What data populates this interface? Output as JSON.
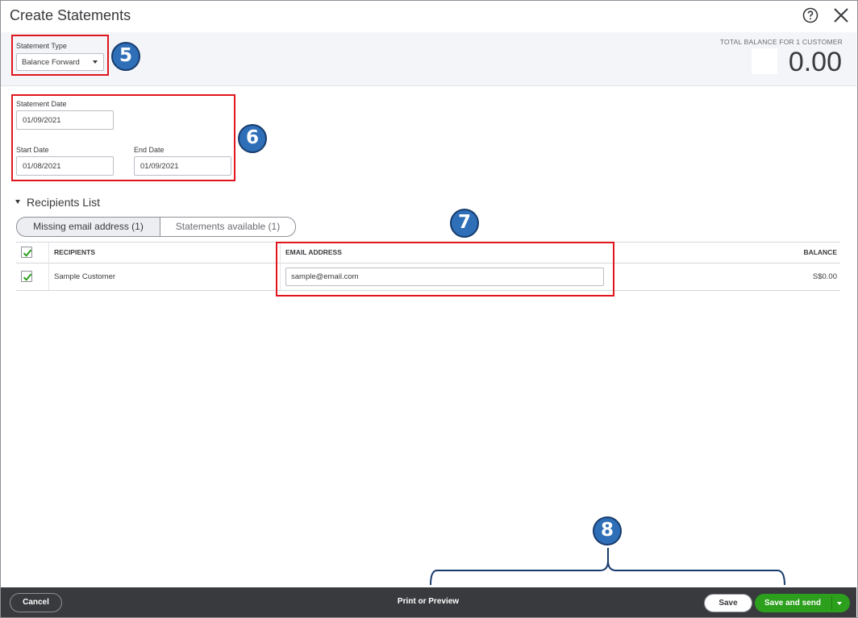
{
  "window": {
    "title": "Create Statements"
  },
  "header": {
    "help_icon": "question-circle-icon",
    "close_icon": "close-x-icon"
  },
  "statement_type": {
    "label": "Statement Type",
    "value": "Balance Forward"
  },
  "total": {
    "label": "TOTAL BALANCE FOR 1 CUSTOMER",
    "amount": "0.00"
  },
  "dates": {
    "statement_date": {
      "label": "Statement Date",
      "value": "01/09/2021"
    },
    "start_date": {
      "label": "Start Date",
      "value": "01/08/2021"
    },
    "end_date": {
      "label": "End Date",
      "value": "01/09/2021"
    }
  },
  "recipients": {
    "heading": "Recipients List",
    "tabs": [
      {
        "label": "Missing email address (1)",
        "active": true
      },
      {
        "label": "Statements available (1)",
        "active": false
      }
    ],
    "columns": [
      "RECIPIENTS",
      "EMAIL ADDRESS",
      "BALANCE"
    ],
    "rows": [
      {
        "checked": true,
        "recipient": "Sample Customer",
        "email": "sample@email.com",
        "balance": "S$0.00"
      }
    ]
  },
  "annotations": {
    "badges": [
      "5",
      "6",
      "7",
      "8"
    ],
    "color": "#e0161e",
    "badge_color": "#2f6fb8"
  },
  "footer": {
    "cancel_label": "Cancel",
    "print_label": "Print or Preview",
    "save_label": "Save",
    "save_send_label": "Save and send",
    "accent": "#2ca01c"
  }
}
